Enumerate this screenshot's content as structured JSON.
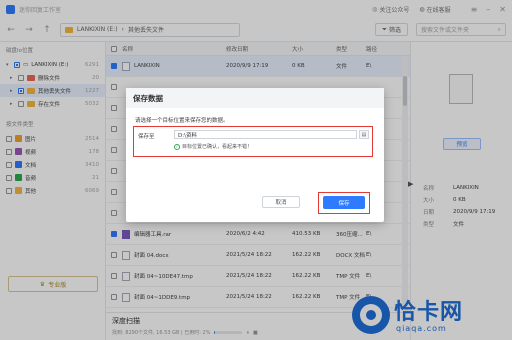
{
  "titlebar": {
    "app_name": "迷你回复工作室",
    "follow": "关注公众号",
    "feedback": "在线客服"
  },
  "toolbar": {
    "path_root": "LANKIXIN (E:)",
    "path_sep": "›",
    "path_current": "其他丢失文件",
    "filter_label": "筛选",
    "search_placeholder": "搜索文件或文件夹"
  },
  "sidebar": {
    "section1": "磁盘Io位置",
    "tree": [
      {
        "label": "LANKIXIN (E:)",
        "count": "6291"
      },
      {
        "label": "删除文件",
        "count": "20"
      },
      {
        "label": "其他丢失文件",
        "count": "1227"
      },
      {
        "label": "存在文件",
        "count": "5032"
      }
    ],
    "section2": "按文件类型",
    "types": [
      {
        "label": "图片",
        "count": "2514"
      },
      {
        "label": "视频",
        "count": "178"
      },
      {
        "label": "文档",
        "count": "3410"
      },
      {
        "label": "音频",
        "count": "21"
      },
      {
        "label": "其他",
        "count": "6069"
      }
    ],
    "pro_label": "专业版"
  },
  "table": {
    "headers": [
      "名称",
      "修改日期",
      "大小",
      "类型",
      "路径"
    ],
    "rows": [
      {
        "name": "LANKIXIN",
        "date": "2020/9/9 17:19",
        "size": "0 KB",
        "type": "文件",
        "path": "E\\"
      },
      {
        "name": "",
        "date": "",
        "size": "",
        "type": "",
        "path": ""
      },
      {
        "name": "",
        "date": "",
        "size": "",
        "type": "",
        "path": ""
      },
      {
        "name": "",
        "date": "",
        "size": "",
        "type": "",
        "path": ""
      },
      {
        "name": "",
        "date": "",
        "size": "",
        "type": "",
        "path": ""
      },
      {
        "name": "",
        "date": "",
        "size": "",
        "type": "",
        "path": ""
      },
      {
        "name": "",
        "date": "",
        "size": "",
        "type": "",
        "path": ""
      },
      {
        "name": "",
        "date": "",
        "size": "",
        "type": "",
        "path": ""
      },
      {
        "name": "编辑器工具.rar",
        "date": "2020/6/2 4:42",
        "size": "410.53 KB",
        "type": "360压缩...",
        "path": "E\\"
      },
      {
        "name": "封面 04.docx",
        "date": "2021/5/24 18:22",
        "size": "162.22 KB",
        "type": "DOCX 文档",
        "path": "E\\"
      },
      {
        "name": "封面 04~10DE47.tmp",
        "date": "2021/5/24 18:22",
        "size": "162.22 KB",
        "type": "TMP 文件",
        "path": "E\\"
      },
      {
        "name": "封面 04~1DDE9.tmp",
        "date": "2021/5/24 18:22",
        "size": "162.22 KB",
        "type": "TMP 文件",
        "path": "E\\"
      }
    ]
  },
  "bottom": {
    "title": "深度扫描",
    "status": "找到: 8290个文件, 16.53 GB | 已用时: 2%",
    "progress_percent": 2
  },
  "preview": {
    "button": "预览",
    "info": [
      {
        "k": "名称",
        "v": "LANKIXIN"
      },
      {
        "k": "大小",
        "v": "0 KB"
      },
      {
        "k": "日期",
        "v": "2020/9/9 17:19"
      },
      {
        "k": "类型",
        "v": "文件"
      }
    ]
  },
  "dialog": {
    "title": "保存数据",
    "desc": "请选择一个目标位置来保存您的数据。",
    "path_label": "保存至",
    "path_value": "D:\\资料",
    "confirm_text": "目标位置已确认，看起来不错！",
    "cancel": "取消",
    "save": "保存"
  },
  "watermark": {
    "text": "恰卡网",
    "url": "qiaqa.com"
  },
  "colors": {
    "accent": "#2f7bff",
    "highlight": "#e53935",
    "folder": "#f5b841"
  }
}
